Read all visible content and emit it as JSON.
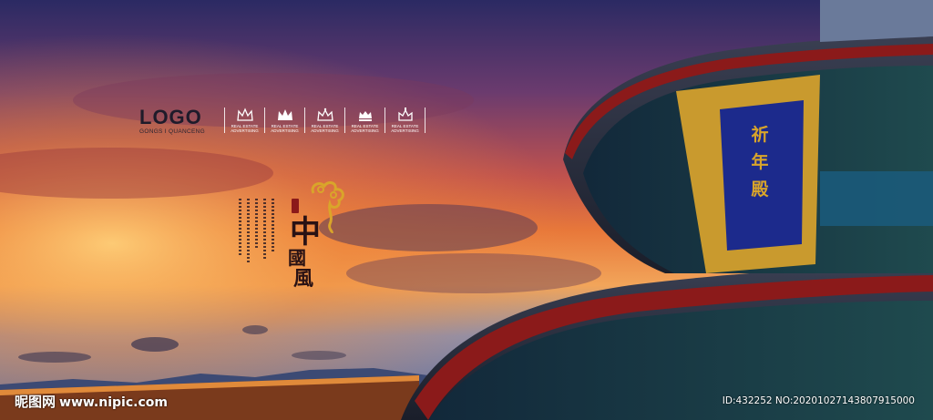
{
  "logo": {
    "title": "LOGO",
    "subtitle": "GONGS I QUANCENG"
  },
  "badges": [
    {
      "icon": "crown-icon",
      "line1": "REAL ESTATE",
      "line2": "ADVERTISING"
    },
    {
      "icon": "crown-icon",
      "line1": "REAL ESTATE",
      "line2": "ADVERTISING"
    },
    {
      "icon": "crown-icon",
      "line1": "REAL ESTATE",
      "line2": "ADVERTISING"
    },
    {
      "icon": "crown-icon",
      "line1": "REAL ESTATE",
      "line2": "ADVERTISING"
    },
    {
      "icon": "crown-icon",
      "line1": "REAL ESTATE",
      "line2": "ADVERTISING"
    }
  ],
  "calligraphy": {
    "c1": "中",
    "c2": "國",
    "c3": "風"
  },
  "plaque": {
    "c1": "祈",
    "c2": "年",
    "c3": "殿"
  },
  "watermark": {
    "site_cn": "昵图网",
    "url": "www.nipic.com",
    "id": "ID:432252 NO:20201027143807915000"
  },
  "colors": {
    "sky_top": "#2c2a62",
    "sky_glow": "#e06a2c",
    "plaque_blue": "#1c2a8c",
    "gold": "#c99a2e"
  }
}
